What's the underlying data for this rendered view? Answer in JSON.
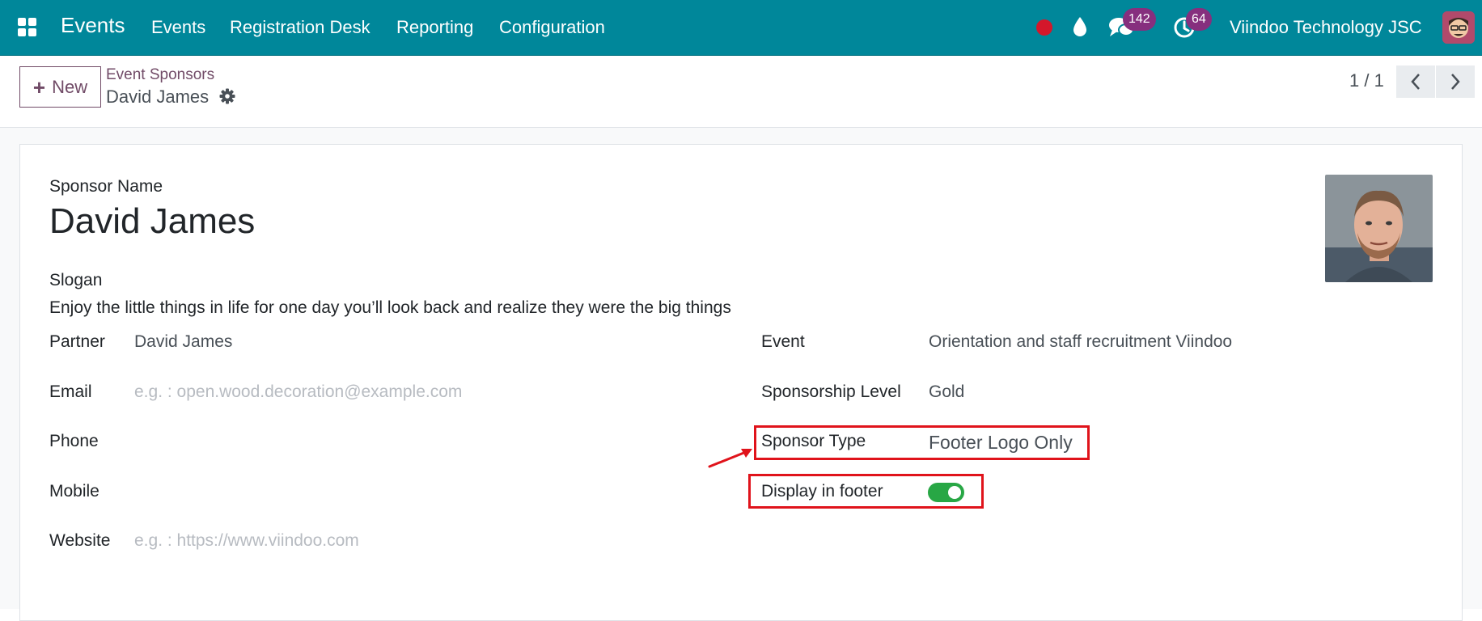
{
  "navbar": {
    "app_name": "Events",
    "menu": [
      "Events",
      "Registration Desk",
      "Reporting",
      "Configuration"
    ],
    "messages_count": "142",
    "activities_count": "64",
    "company": "Viindoo Technology JSC",
    "icons": [
      "apps-grid-icon",
      "recording-dot-icon",
      "drop-icon",
      "chat-bubbles-icon",
      "clock-icon",
      "user-avatar"
    ],
    "colors": {
      "bar": "#00879a",
      "badge": "#862f7e",
      "record_dot": "#d4172b"
    }
  },
  "control_panel": {
    "new_label": "New",
    "breadcrumb_parent": "Event Sponsors",
    "breadcrumb_current": "David James",
    "pager": "1 / 1"
  },
  "form": {
    "sponsor_name_label": "Sponsor Name",
    "sponsor_name": "David James",
    "slogan_label": "Slogan",
    "slogan": "Enjoy the little things in life for one day you’ll look back and realize they were the big things",
    "left_fields": {
      "partner_label": "Partner",
      "partner_value": "David James",
      "email_label": "Email",
      "email_placeholder": "e.g. : open.wood.decoration@example.com",
      "phone_label": "Phone",
      "mobile_label": "Mobile",
      "website_label": "Website",
      "website_placeholder": "e.g. : https://www.viindoo.com"
    },
    "right_fields": {
      "event_label": "Event",
      "event_value": "Orientation and staff recruitment Viindoo",
      "level_label": "Sponsorship Level",
      "level_value": "Gold",
      "type_label": "Sponsor Type",
      "type_value": "Footer Logo Only",
      "footer_label": "Display in footer",
      "footer_enabled": true
    },
    "colors": {
      "highlight": "#e0131b",
      "toggle_on": "#28a745",
      "brand": "#714b67"
    }
  }
}
